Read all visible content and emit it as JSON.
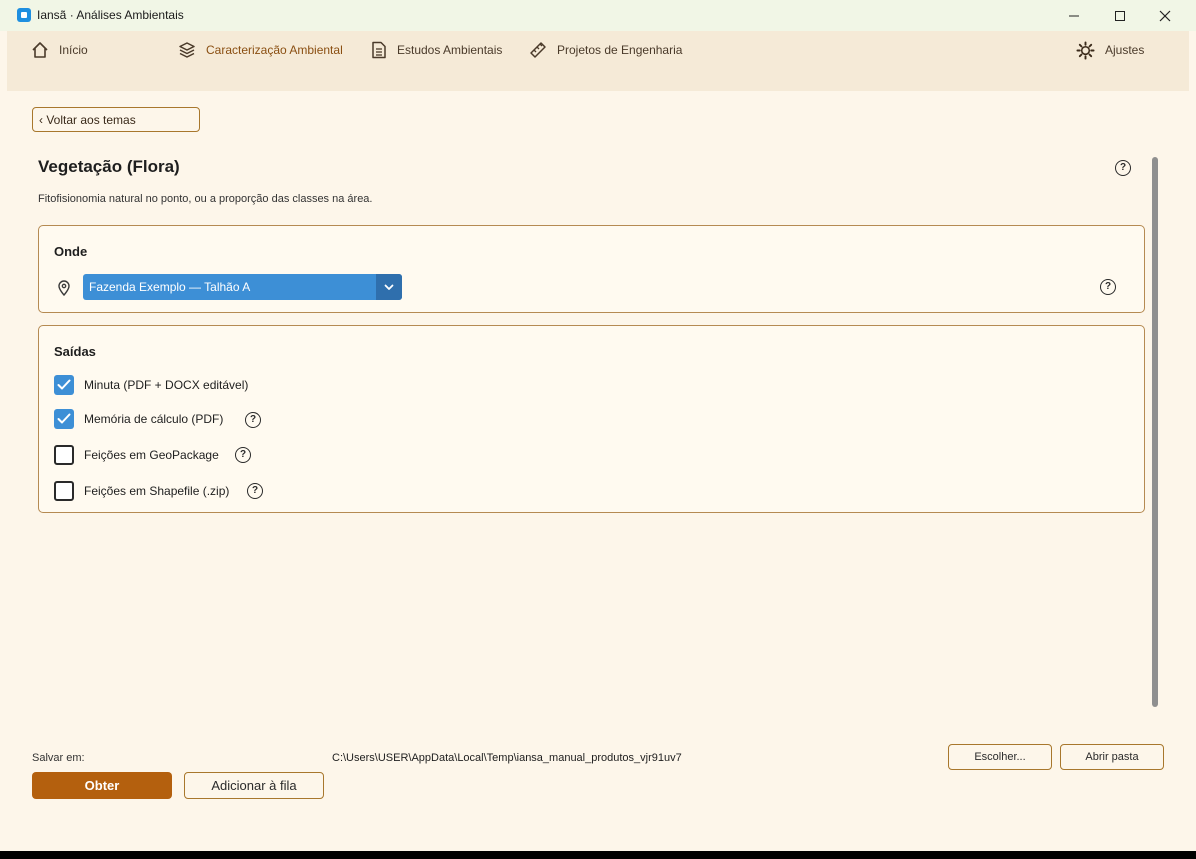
{
  "window": {
    "title": "Iansã · Análises Ambientais"
  },
  "nav": {
    "items": [
      {
        "label": "Início",
        "icon": "home-icon"
      },
      {
        "label": "Caracterização Ambiental",
        "icon": "layers-icon"
      },
      {
        "label": "Estudos Ambientais",
        "icon": "document-icon"
      },
      {
        "label": "Projetos de Engenharia",
        "icon": "ruler-icon"
      }
    ],
    "settings_label": "Ajustes",
    "active": "Caracterização Ambiental"
  },
  "content": {
    "back_label": "‹ Voltar aos temas",
    "title": "Vegetação (Flora)",
    "description": "Fitofisionomia natural no ponto, ou a proporção das classes na área.",
    "where": {
      "title": "Onde",
      "selected": "Fazenda Exemplo — Talhão A"
    },
    "outputs": {
      "title": "Saídas",
      "items": [
        {
          "label": "Minuta (PDF + DOCX editável)",
          "checked": true
        },
        {
          "label": "Memória de cálculo (PDF)",
          "checked": true
        },
        {
          "label": "Feições em GeoPackage",
          "checked": false
        },
        {
          "label": "Feições em Shapefile (.zip)",
          "checked": false
        }
      ]
    }
  },
  "footer": {
    "save_label": "Salvar em:",
    "save_path": "C:\\Users\\USER\\AppData\\Local\\Temp\\iansa_manual_produtos_vjr91uv7",
    "choose_label": "Escolher...",
    "open_folder_label": "Abrir pasta",
    "obtain_label": "Obter",
    "queue_label": "Adicionar à fila"
  },
  "colors": {
    "accent": "#b4600e",
    "select_blue": "#3d8fd6",
    "background": "#fdf6ea",
    "nav_bg": "#f5ead7"
  }
}
